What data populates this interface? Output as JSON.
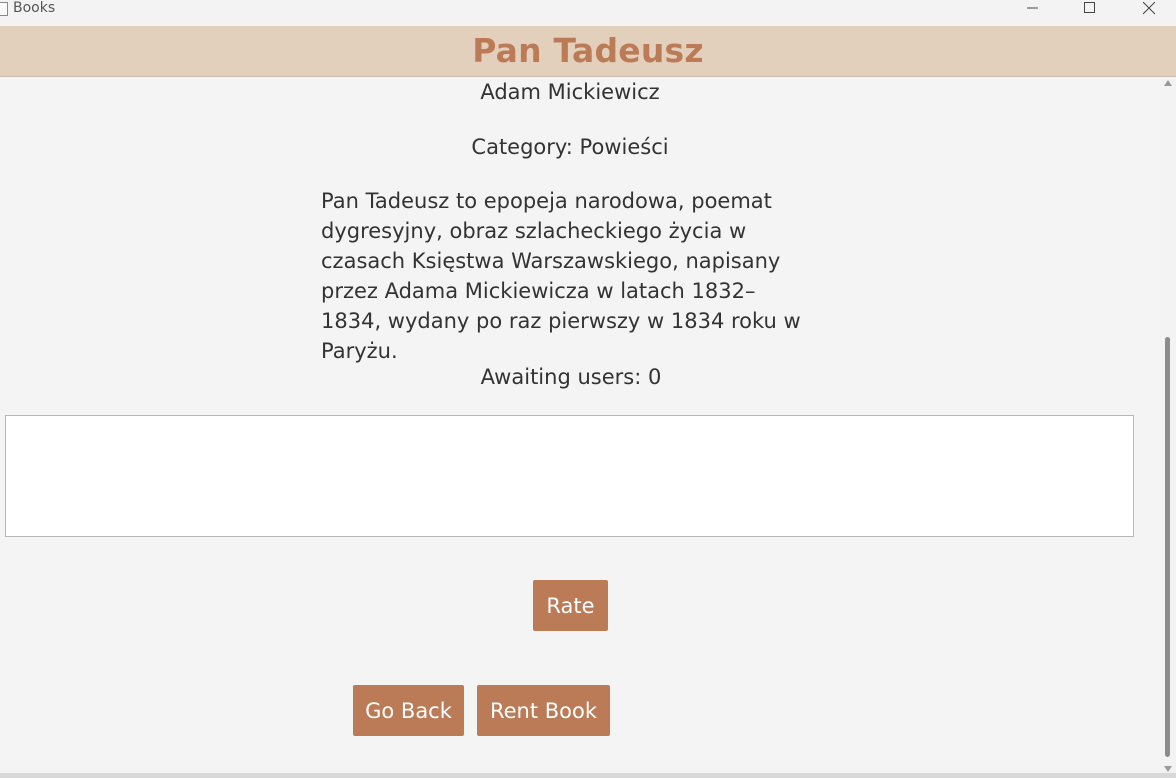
{
  "window": {
    "app_title": "Books"
  },
  "book": {
    "title": "Pan Tadeusz",
    "author": "Adam Mickiewicz",
    "category_text": "Category: Powieści",
    "description": "Pan Tadeusz to epopeja narodowa, poemat dygresyjny, obraz szlacheckiego życia w czasach Księstwa Warszawskiego, napisany przez Adama Mickiewicza w latach 1832–1834, wydany po raz pierwszy w 1834 roku w Paryżu.",
    "awaiting_text": "Awaiting users: 0"
  },
  "review": {
    "value": ""
  },
  "buttons": {
    "rate": "Rate",
    "go_back": "Go Back",
    "rent_book": "Rent Book"
  },
  "colors": {
    "accent": "#bc7b57",
    "header_bg": "#e2d0bd"
  }
}
